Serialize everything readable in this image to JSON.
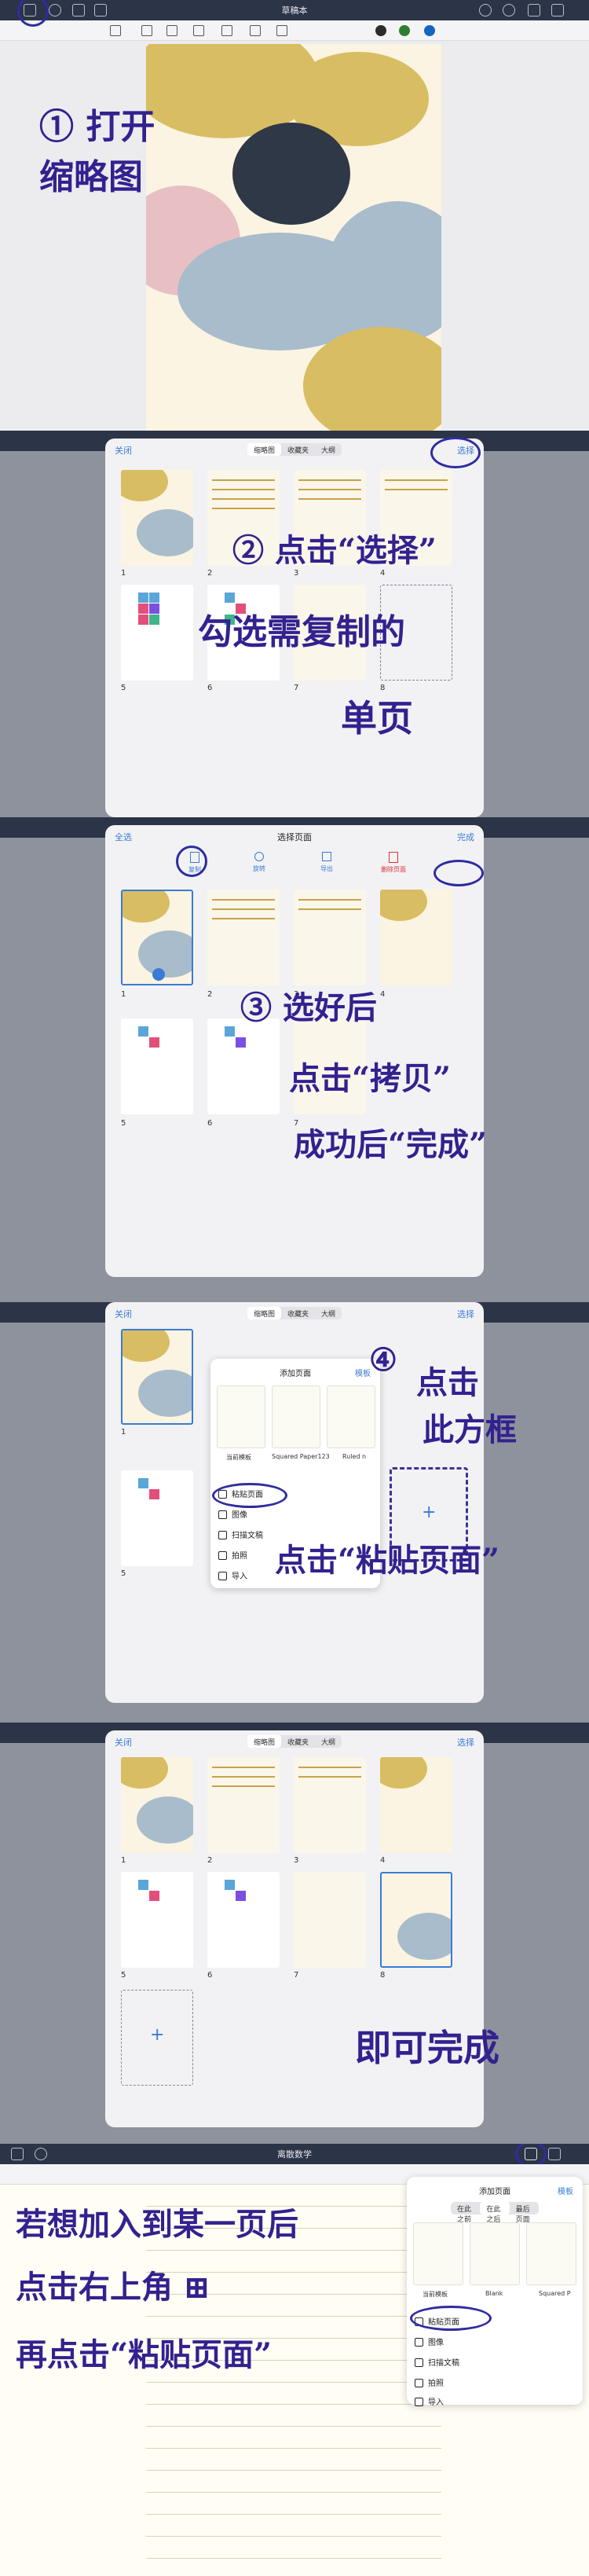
{
  "step1": {
    "toolbar_title": "草稿本",
    "annotation": "① 打开\n缩略图",
    "colors": [
      "#2c2c2c",
      "#2e7d32",
      "#1565c0"
    ]
  },
  "step2": {
    "close": "关闭",
    "tabs": [
      "缩略图",
      "收藏夹",
      "大纲"
    ],
    "select": "选择",
    "page_numbers": [
      "1",
      "2",
      "3",
      "4",
      "5",
      "6",
      "7",
      "8"
    ],
    "annotation_a": "② 点击“选择”",
    "annotation_b": "勾选需复制的",
    "annotation_c": "单页"
  },
  "step3": {
    "select_all": "全选",
    "title": "选择页面",
    "done": "完成",
    "actions": [
      "复制",
      "旋转",
      "导出",
      "删除页面"
    ],
    "page_numbers": [
      "1",
      "2",
      "3",
      "4",
      "5",
      "6",
      "7"
    ],
    "annotation_a": "③ 选好后",
    "annotation_b": "点击“拷贝”",
    "annotation_c": "成功后“完成”"
  },
  "step4": {
    "close": "关闭",
    "tabs": [
      "缩略图",
      "收藏夹",
      "大纲"
    ],
    "select": "选择",
    "popup_title": "添加页面",
    "popup_right": "模板",
    "templates": [
      "当前模板",
      "Squared Paper123",
      "Ruled n"
    ],
    "menu": [
      "粘贴页面",
      "图像",
      "扫描文稿",
      "拍照",
      "导入"
    ],
    "annotation_num": "④",
    "annotation_a": "点击",
    "annotation_b": "此方框",
    "annotation_c": "点击“粘贴页面”",
    "page_numbers": [
      "1",
      "5"
    ]
  },
  "step5": {
    "close": "关闭",
    "tabs": [
      "缩略图",
      "收藏夹",
      "大纲"
    ],
    "select": "选择",
    "page_numbers": [
      "1",
      "2",
      "3",
      "4",
      "5",
      "6",
      "7",
      "8"
    ],
    "annotation": "即可完成"
  },
  "step6": {
    "toolbar_title": "离散数学",
    "popup_title": "添加页面",
    "popup_right": "模板",
    "tabs": [
      "在此之前",
      "在此之后",
      "最后页面"
    ],
    "templates": [
      "当前模板",
      "Blank",
      "Squared P"
    ],
    "menu": [
      "粘贴页面",
      "图像",
      "扫描文稿",
      "拍照",
      "导入"
    ],
    "annotation_a": "若想加入到某一页后",
    "annotation_b": "点击右上角 ⊞",
    "annotation_c": "再点击“粘贴页面”"
  }
}
